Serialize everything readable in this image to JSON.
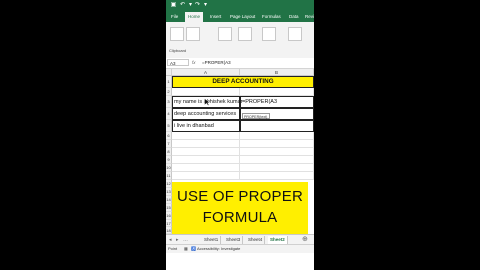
{
  "ribbon": {
    "tabs": [
      "File",
      "Home",
      "Insert",
      "Page Layout",
      "Formulas",
      "Data",
      "Revi"
    ],
    "active_tab": "Home",
    "clipboard_label": "Clipboard"
  },
  "formula_bar": {
    "name_box": "A3",
    "fx": "fx",
    "formula": "=PROPER(A3"
  },
  "columns": [
    "A",
    "B"
  ],
  "rows": [
    "1",
    "2",
    "3",
    "4",
    "5",
    "6",
    "7",
    "8",
    "9",
    "10",
    "11",
    "12",
    "13",
    "14",
    "15",
    "16",
    "17",
    "18",
    "19",
    "20"
  ],
  "cells": {
    "title": "DEEP ACCOUNTING",
    "a3": "my name is abhishek kumar",
    "b3": "=PROPER(A3",
    "a4": "deep accounting services",
    "a5": "i live in dhanbad",
    "tooltip": "PROPER(text)"
  },
  "banner": {
    "line1": "USE OF PROPER",
    "line2": "FORMULA"
  },
  "sheets": [
    "Sheet1",
    "Sheet3",
    "Sheet4",
    "Sheet2"
  ],
  "active_sheet": "Sheet2",
  "status": {
    "mode": "Point",
    "accessibility": "Accessibility: Investigate"
  },
  "colors": {
    "excel_green": "#217346",
    "highlight_yellow": "#ffef00"
  }
}
